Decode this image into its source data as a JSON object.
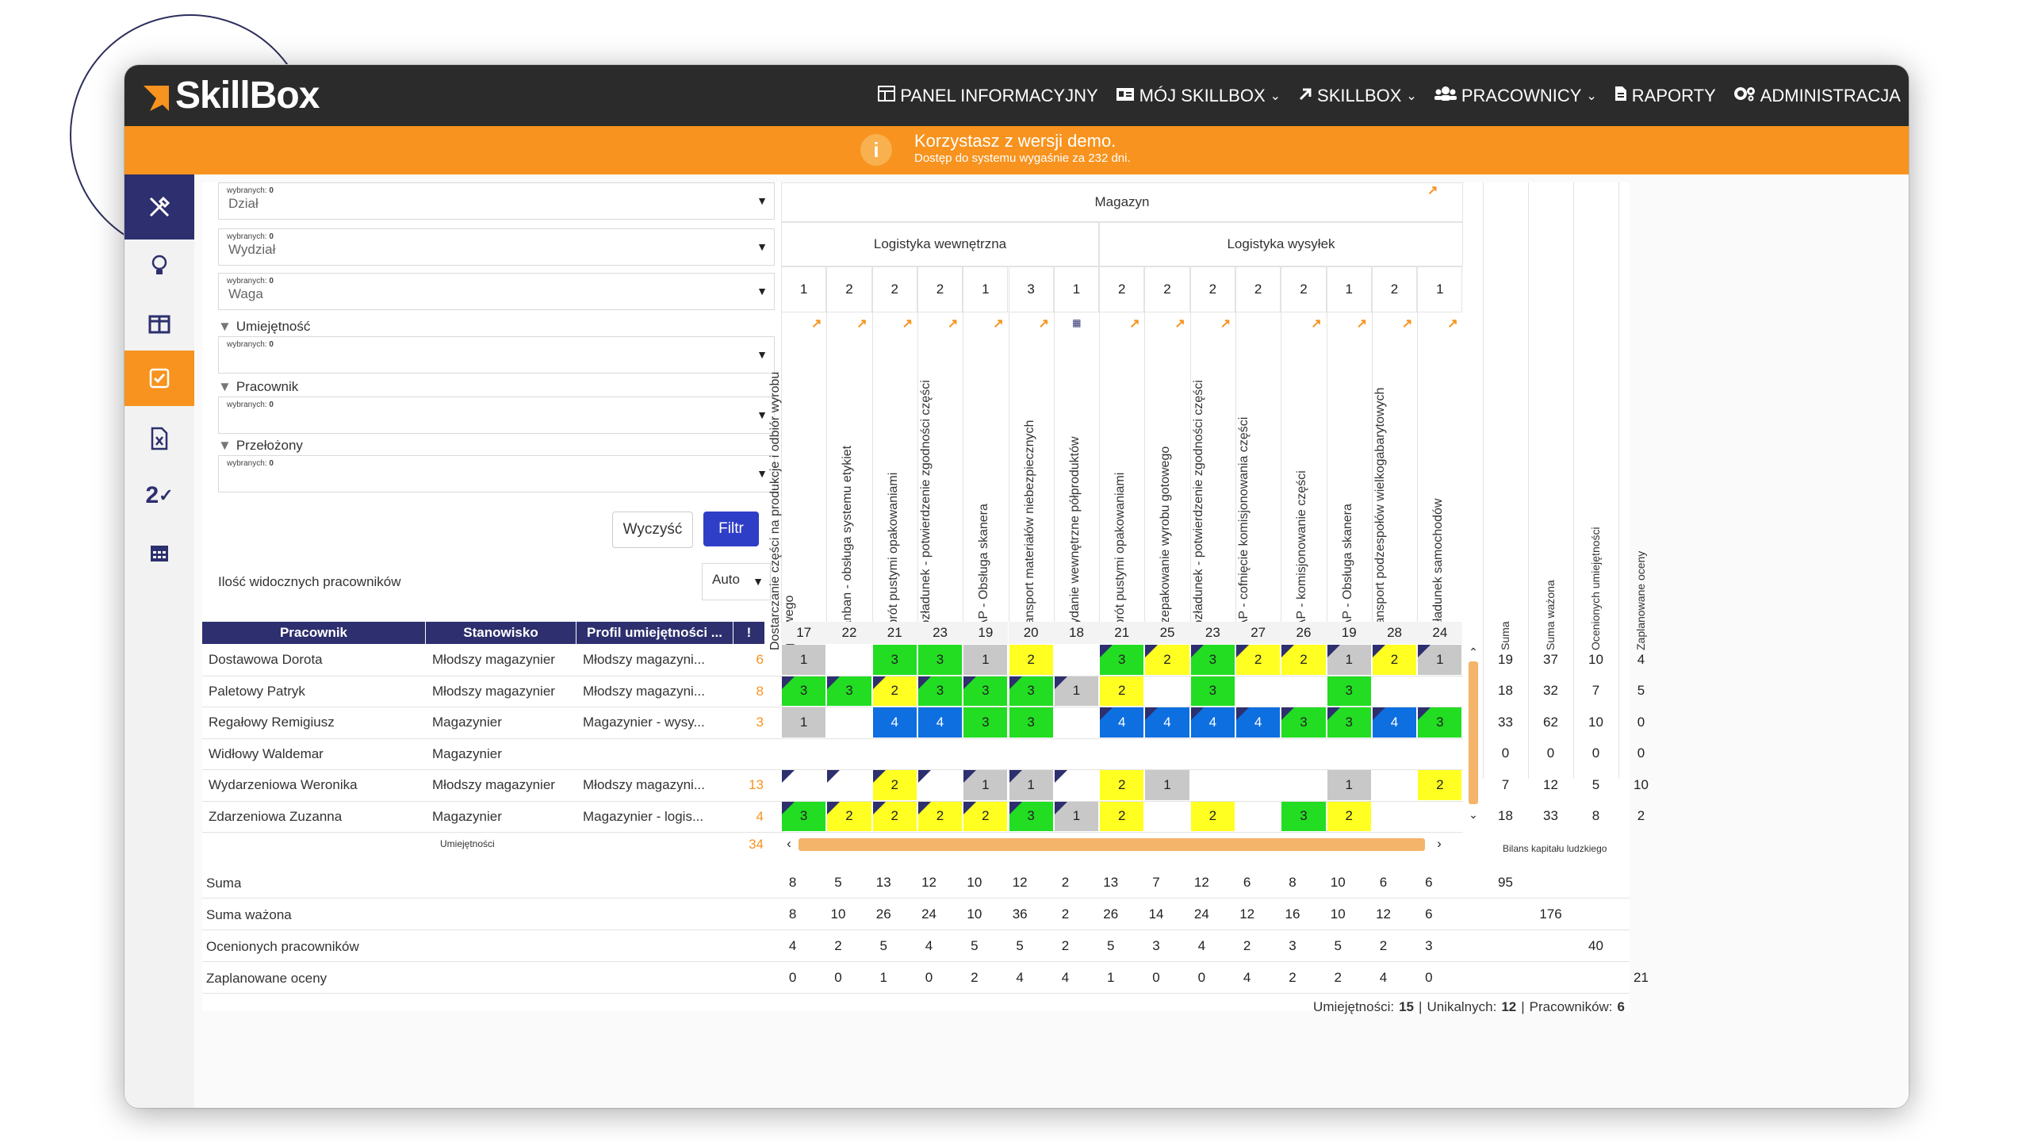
{
  "app": {
    "logo": "SkillBox"
  },
  "nav": [
    {
      "label": "PANEL INFORMACYJNY",
      "icon": "dashboard-icon",
      "caret": false
    },
    {
      "label": "MÓJ SKILLBOX",
      "icon": "id-card-icon",
      "caret": true
    },
    {
      "label": "SKILLBOX",
      "icon": "arrow-up-right-icon",
      "caret": true
    },
    {
      "label": "PRACOWNICY",
      "icon": "users-icon",
      "caret": true
    },
    {
      "label": "RAPORTY",
      "icon": "file-icon",
      "caret": false
    },
    {
      "label": "ADMINISTRACJA",
      "icon": "cogs-icon",
      "caret": false
    }
  ],
  "banner": {
    "icon": "info-icon",
    "title": "Korzystasz z wersji demo.",
    "subtitle": "Dostęp do systemu wygaśnie za 232 dni."
  },
  "sidebar": [
    "tools-icon",
    "lightbulb-icon",
    "columns-icon",
    "checkbox-icon",
    "excel-file-icon",
    "2-check-icon",
    "calendar-icon"
  ],
  "filters": {
    "selected_prefix": "wybranych:",
    "selected_count": "0",
    "dzial": "Dział",
    "wydzial": "Wydział",
    "waga": "Waga",
    "umiejetnosc": "Umiejętność",
    "pracownik": "Pracownik",
    "przelozony": "Przełożony",
    "clear_label": "Wyczyść",
    "filter_label": "Filtr",
    "visible_label": "Ilość widocznych pracowników",
    "visible_value": "Auto"
  },
  "matrix": {
    "department": "Magazyn",
    "groups": [
      "Logistyka wewnętrzna",
      "Logistyka wysyłek"
    ],
    "weights": [
      "1",
      "2",
      "2",
      "2",
      "1",
      "3",
      "1",
      "2",
      "2",
      "2",
      "2",
      "2",
      "1",
      "2",
      "1"
    ],
    "skills": [
      "Dostarczanie części na produkcje i odbiór wyrobu gotowego",
      "Kanban - obsługa systemu etykiet",
      "Obrót pustymi opakowaniami",
      "Rozładunek - potwierdzenie zgodności części",
      "SAP - Obsługa skanera",
      "Transport materiałów niebezpiecznych",
      "Wydanie wewnętrzne półproduktów",
      "Obrót pustymi opakowaniami",
      "Przepakowanie wyrobu gotowego",
      "Rozładunek - potwierdzenie zgodności części",
      "SAP - cofnięcie komisjonowania części",
      "SAP - komisjonowanie części",
      "SAP - Obsługa skanera",
      "Transport podzespołów wielkogabarytowych",
      "Załadunek samochodów"
    ],
    "skill_totals": [
      "17",
      "22",
      "21",
      "23",
      "19",
      "20",
      "18",
      "21",
      "25",
      "23",
      "27",
      "26",
      "19",
      "28",
      "24"
    ],
    "headers": {
      "pracownik": "Pracownik",
      "stanowisko": "Stanowisko",
      "profil": "Profil umiejętności ...",
      "excl": "!"
    },
    "employees": [
      {
        "name": "Dostawowa Dorota",
        "position": "Młodszy magazynier",
        "profile": "Młodszy magazyni...",
        "count": "6"
      },
      {
        "name": "Paletowy Patryk",
        "position": "Młodszy magazynier",
        "profile": "Młodszy magazyni...",
        "count": "8"
      },
      {
        "name": "Regałowy Remigiusz",
        "position": "Magazynier",
        "profile": "Magazynier - wysy...",
        "count": "3"
      },
      {
        "name": "Widłowy Waldemar",
        "position": "Magazynier",
        "profile": "",
        "count": ""
      },
      {
        "name": "Wydarzeniowa Weronika",
        "position": "Młodszy magazynier",
        "profile": "Młodszy magazyni...",
        "count": "13"
      },
      {
        "name": "Zdarzeniowa Zuzanna",
        "position": "Magazynier",
        "profile": "Magazynier - logis...",
        "count": "4"
      }
    ],
    "cells": [
      [
        [
          "1",
          "g",
          false
        ],
        [
          "",
          "",
          false
        ],
        [
          "3",
          "G",
          false
        ],
        [
          "3",
          "G",
          false
        ],
        [
          "1",
          "g",
          false
        ],
        [
          "2",
          "Y",
          false
        ],
        [
          "",
          "",
          false
        ],
        [
          "3",
          "G",
          true
        ],
        [
          "2",
          "Y",
          true
        ],
        [
          "3",
          "G",
          true
        ],
        [
          "2",
          "Y",
          true
        ],
        [
          "2",
          "Y",
          true
        ],
        [
          "1",
          "g",
          true
        ],
        [
          "2",
          "Y",
          true
        ],
        [
          "1",
          "g",
          true
        ]
      ],
      [
        [
          "3",
          "G",
          true
        ],
        [
          "3",
          "G",
          true
        ],
        [
          "2",
          "Y",
          true
        ],
        [
          "3",
          "G",
          true
        ],
        [
          "3",
          "G",
          true
        ],
        [
          "3",
          "G",
          true
        ],
        [
          "1",
          "g",
          true
        ],
        [
          "2",
          "Y",
          false
        ],
        [
          "",
          "",
          false
        ],
        [
          "3",
          "G",
          false
        ],
        [
          "",
          "",
          false
        ],
        [
          "",
          "",
          false
        ],
        [
          "3",
          "G",
          false
        ],
        [
          "",
          "",
          false
        ],
        [
          "",
          "",
          false
        ]
      ],
      [
        [
          "1",
          "g",
          false
        ],
        [
          "",
          "",
          false
        ],
        [
          "4",
          "B",
          false
        ],
        [
          "4",
          "B",
          false
        ],
        [
          "3",
          "G",
          false
        ],
        [
          "3",
          "G",
          false
        ],
        [
          "",
          "",
          false
        ],
        [
          "4",
          "B",
          true
        ],
        [
          "4",
          "B",
          true
        ],
        [
          "4",
          "B",
          true
        ],
        [
          "4",
          "B",
          true
        ],
        [
          "3",
          "G",
          true
        ],
        [
          "3",
          "G",
          true
        ],
        [
          "4",
          "B",
          true
        ],
        [
          "3",
          "G",
          true
        ]
      ],
      [
        [
          "",
          "",
          false
        ],
        [
          "",
          "",
          false
        ],
        [
          "",
          "",
          false
        ],
        [
          "",
          "",
          false
        ],
        [
          "",
          "",
          false
        ],
        [
          "",
          "",
          false
        ],
        [
          "",
          "",
          false
        ],
        [
          "",
          "",
          false
        ],
        [
          "",
          "",
          false
        ],
        [
          "",
          "",
          false
        ],
        [
          "",
          "",
          false
        ],
        [
          "",
          "",
          false
        ],
        [
          "",
          "",
          false
        ],
        [
          "",
          "",
          false
        ],
        [
          "",
          "",
          false
        ]
      ],
      [
        [
          "",
          "",
          true
        ],
        [
          "",
          "",
          true
        ],
        [
          "2",
          "Y",
          true
        ],
        [
          "",
          "",
          true
        ],
        [
          "1",
          "g",
          true
        ],
        [
          "1",
          "g",
          true
        ],
        [
          "",
          "",
          true
        ],
        [
          "2",
          "Y",
          false
        ],
        [
          "1",
          "g",
          false
        ],
        [
          "",
          "",
          false
        ],
        [
          "",
          "",
          false
        ],
        [
          "",
          "",
          false
        ],
        [
          "1",
          "g",
          false
        ],
        [
          "",
          "",
          false
        ],
        [
          "2",
          "Y",
          false
        ]
      ],
      [
        [
          "3",
          "G",
          true
        ],
        [
          "2",
          "Y",
          true
        ],
        [
          "2",
          "Y",
          true
        ],
        [
          "2",
          "Y",
          true
        ],
        [
          "2",
          "Y",
          true
        ],
        [
          "3",
          "G",
          true
        ],
        [
          "1",
          "g",
          true
        ],
        [
          "2",
          "Y",
          false
        ],
        [
          "",
          "",
          false
        ],
        [
          "2",
          "Y",
          false
        ],
        [
          "",
          "",
          false
        ],
        [
          "3",
          "G",
          false
        ],
        [
          "2",
          "Y",
          false
        ],
        [
          "",
          "",
          false
        ],
        [
          "",
          "",
          false
        ]
      ]
    ],
    "umiejetnosci_label": "Umiejętności",
    "umiejetnosci_value": "34",
    "summary": [
      {
        "label": "Suma",
        "values": [
          "8",
          "5",
          "13",
          "12",
          "10",
          "12",
          "2",
          "13",
          "7",
          "12",
          "6",
          "8",
          "10",
          "6",
          "6"
        ]
      },
      {
        "label": "Suma ważona",
        "values": [
          "8",
          "10",
          "26",
          "24",
          "10",
          "36",
          "2",
          "26",
          "14",
          "24",
          "12",
          "16",
          "10",
          "12",
          "6"
        ]
      },
      {
        "label": "Ocenionych pracowników",
        "values": [
          "4",
          "2",
          "5",
          "4",
          "5",
          "5",
          "2",
          "5",
          "3",
          "4",
          "2",
          "3",
          "5",
          "2",
          "3"
        ]
      },
      {
        "label": "Zaplanowane oceny",
        "values": [
          "0",
          "0",
          "1",
          "0",
          "2",
          "4",
          "4",
          "1",
          "0",
          "0",
          "4",
          "2",
          "2",
          "4",
          "0"
        ]
      }
    ],
    "right_headers": [
      "Suma",
      "Suma ważona",
      "Ocenionych umiejętności",
      "Zaplanowane oceny"
    ],
    "right_rows": [
      [
        "19",
        "37",
        "10",
        "4"
      ],
      [
        "18",
        "32",
        "7",
        "5"
      ],
      [
        "33",
        "62",
        "10",
        "0"
      ],
      [
        "0",
        "0",
        "0",
        "0"
      ],
      [
        "7",
        "12",
        "5",
        "10"
      ],
      [
        "18",
        "33",
        "8",
        "2"
      ]
    ],
    "right_caption": "Bilans kapitału ludzkiego",
    "right_totals": [
      "95",
      "176",
      "40",
      "21"
    ],
    "footer": {
      "skills_label": "Umiejętności:",
      "skills": "15",
      "unique_label": "Unikalnych:",
      "unique": "12",
      "employees_label": "Pracowników:",
      "employees": "6"
    }
  },
  "colors": {
    "accent": "#f7931e",
    "navy": "#2d2f6e",
    "green": "#22dd22",
    "yellow": "#ffff22",
    "blue": "#0d6fe0",
    "gray": "#c8c8c8"
  }
}
